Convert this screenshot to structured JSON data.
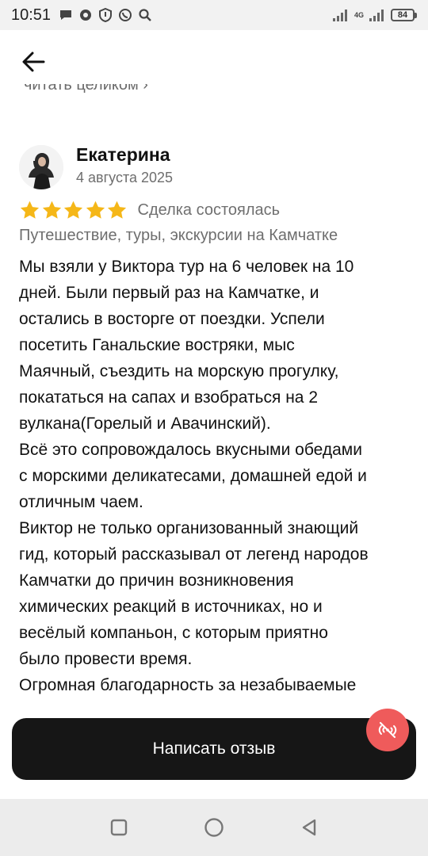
{
  "status_bar": {
    "time": "10:51",
    "network": "4G",
    "battery": "84"
  },
  "header": {
    "back_icon": "arrow-left-icon",
    "cut_text": "читать целиком ›"
  },
  "review": {
    "author": "Екатерина",
    "date": "4 августа 2025",
    "stars": 5,
    "star_color": "#f5b718",
    "deal_status": "Сделка состоялась",
    "category": "Путешествие, туры, экскурсии на Камчатке",
    "lines": [
      "Мы взяли у Виктора тур на 6 человек на 10",
      "дней. Были первый раз на Камчатке, и",
      "остались в восторге от поездки. Успели",
      "посетить Ганальские востряки, мыс",
      "Маячный, съездить на морскую прогулку,",
      "покататься на сапах и взобраться на 2",
      "вулкана(Горелый и Авачинский).",
      "Всё это сопровождалось вкусными обедами",
      "с морскими деликатесами, домашней едой и",
      "отличным чаем.",
      "Виктор не только организованный знающий",
      "гид, который рассказывал от легенд народов",
      "Камчатки до причин возникновения",
      "химических реакций в  источниках, но и",
      "весёлый компаньон, с которым приятно",
      "было провести время.",
      " Огромная благодарность за незабываемые"
    ]
  },
  "actions": {
    "write_review": "Написать отзыв",
    "badge_icon": "no-signal-icon",
    "badge_color": "#ef5b5b"
  },
  "nav": {
    "icons": [
      "recent-apps-icon",
      "home-icon",
      "back-triangle-icon"
    ]
  }
}
